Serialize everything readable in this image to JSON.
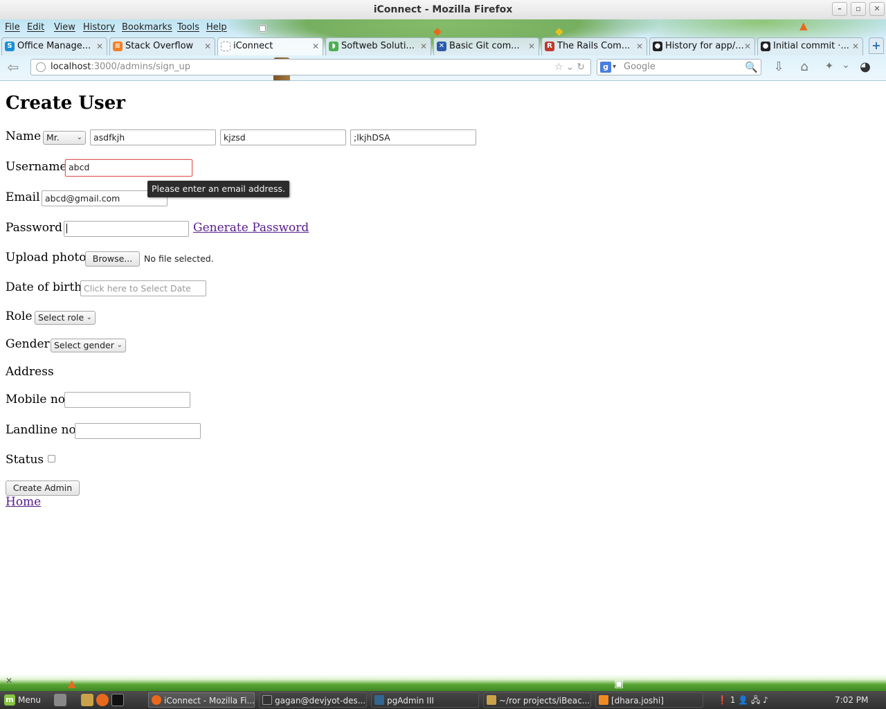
{
  "window": {
    "title": "iConnect - Mozilla Firefox",
    "controls": {
      "minimize": "–",
      "maximize": "▫",
      "close": "✕"
    }
  },
  "menubar": [
    "File",
    "Edit",
    "View",
    "History",
    "Bookmarks",
    "Tools",
    "Help"
  ],
  "tabs": [
    {
      "label": "Office Manage...",
      "icon": "skype-icon",
      "color": "#1a8fd6",
      "glyph": "S",
      "active": false
    },
    {
      "label": "Stack Overflow",
      "icon": "stackoverflow-icon",
      "color": "#f48024",
      "glyph": "≡",
      "active": false
    },
    {
      "label": "iConnect",
      "icon": "blank-page-icon",
      "color": "#cccccc",
      "glyph": "",
      "active": true
    },
    {
      "label": "Softweb Soluti...",
      "icon": "softweb-icon",
      "color": "#4caf50",
      "glyph": "◗",
      "active": false
    },
    {
      "label": "Basic Git com...",
      "icon": "git-icon",
      "color": "#2b5aa8",
      "glyph": "✕",
      "active": false
    },
    {
      "label": "The Rails Com...",
      "icon": "rails-icon",
      "color": "#c0392b",
      "glyph": "R",
      "active": false
    },
    {
      "label": "History for app/...",
      "icon": "github-icon",
      "color": "#222222",
      "glyph": "●",
      "active": false
    },
    {
      "label": "Initial commit ·...",
      "icon": "github-icon",
      "color": "#222222",
      "glyph": "●",
      "active": false
    }
  ],
  "tab_close": "✕",
  "new_tab": "+",
  "navbar": {
    "url_host": "localhost",
    "url_path": ":3000/admins/sign_up",
    "search_placeholder": "Google",
    "search_engine_glyph": "g",
    "back_glyph": "⇦",
    "url_icons": "☆⌄↻",
    "search_glyph": "🔍",
    "dropdown_glyph": "▾",
    "download_glyph": "⇩",
    "home_glyph": "⌂",
    "addon_glyph": "✦",
    "more_glyph": "⌄",
    "profile_glyph": "◕"
  },
  "form": {
    "title": "Create User",
    "name_label": "Name",
    "title_select": "Mr.",
    "first_name": "asdfkjh",
    "middle_name": "kjzsd",
    "last_name": ";lkjhDSA",
    "username_label": "Username",
    "username_value": "abcd",
    "email_label": "Email",
    "email_value": "abcd@gmail.com",
    "validation_tooltip": "Please enter an email address.",
    "password_label": "Password",
    "password_value": "",
    "generate_password_link": "Generate Password",
    "upload_label": "Upload photo",
    "browse_button": "Browse...",
    "no_file_text": "No file selected.",
    "dob_label": "Date of birth",
    "dob_placeholder": "Click here to Select Date",
    "role_label": "Role",
    "role_select": "Select role",
    "gender_label": "Gender",
    "gender_select": "Select gender",
    "address_label": "Address",
    "mobile_label": "Mobile no",
    "landline_label": "Landline no",
    "status_label": "Status",
    "status_checked": false,
    "submit_button": "Create Admin",
    "home_link": "Home"
  },
  "select_caret": "⌄",
  "taskbar": {
    "menu_label": "Menu",
    "menu_glyph": "m",
    "tasks": [
      {
        "label": "iConnect - Mozilla Fi...",
        "icon": "firefox-icon",
        "color": "#e8691c",
        "active": true
      },
      {
        "label": "gagan@devjyot-des...",
        "icon": "terminal-icon",
        "color": "#333333",
        "active": false
      },
      {
        "label": "pgAdmin III",
        "icon": "pgadmin-icon",
        "color": "#336791",
        "active": false
      },
      {
        "label": "~/ror projects/iBeac...",
        "icon": "folder-icon",
        "color": "#c9a24a",
        "active": false
      },
      {
        "label": "[dhara.joshi]",
        "icon": "pidgin-icon",
        "color": "#f08a24",
        "active": false
      }
    ],
    "tray_text": "❗ 1 👤 🖧 ♪",
    "clock": "7:02 PM"
  }
}
